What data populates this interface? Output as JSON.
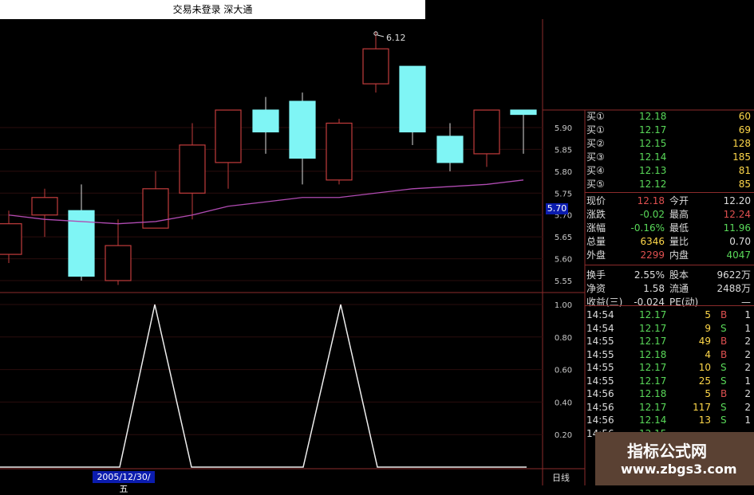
{
  "window": {
    "title": "交易未登录  深大通"
  },
  "chart": {
    "main_axis_labels": [
      "5.90",
      "5.85",
      "5.80",
      "5.75",
      "5.70",
      "5.65",
      "5.60",
      "5.55"
    ],
    "indicator_axis_labels": [
      "1.00",
      "0.80",
      "0.60",
      "0.40",
      "0.20"
    ],
    "high_annotation": "6.12",
    "current_price_box": "5.70",
    "date_label": "2005/12/30/五",
    "period_label": "日线",
    "colors": {
      "up": "#c23c3c",
      "down": "#7ff5f5",
      "ma": "#b04bb2",
      "grid": "#8b2b2b",
      "text": "#ddd"
    }
  },
  "chart_data": [
    {
      "type": "candlestick",
      "title": "",
      "yticks": [
        5.55,
        5.6,
        5.65,
        5.7,
        5.75,
        5.8,
        5.85,
        5.9
      ],
      "candles": [
        {
          "open": 5.61,
          "close": 5.68,
          "high": 5.71,
          "low": 5.59,
          "dir": "up"
        },
        {
          "open": 5.7,
          "close": 5.74,
          "high": 5.76,
          "low": 5.65,
          "dir": "up"
        },
        {
          "open": 5.71,
          "close": 5.56,
          "high": 5.77,
          "low": 5.55,
          "dir": "down"
        },
        {
          "open": 5.55,
          "close": 5.63,
          "high": 5.69,
          "low": 5.54,
          "dir": "up"
        },
        {
          "open": 5.67,
          "close": 5.76,
          "high": 5.8,
          "low": 5.67,
          "dir": "up"
        },
        {
          "open": 5.75,
          "close": 5.86,
          "high": 5.91,
          "low": 5.69,
          "dir": "up"
        },
        {
          "open": 5.82,
          "close": 5.94,
          "high": 5.94,
          "low": 5.76,
          "dir": "up"
        },
        {
          "open": 5.94,
          "close": 5.89,
          "high": 5.97,
          "low": 5.84,
          "dir": "down"
        },
        {
          "open": 5.96,
          "close": 5.83,
          "high": 5.98,
          "low": 5.77,
          "dir": "down"
        },
        {
          "open": 5.78,
          "close": 5.91,
          "high": 5.92,
          "low": 5.77,
          "dir": "up"
        },
        {
          "open": 6.08,
          "close": 6.0,
          "high": 6.12,
          "low": 5.98,
          "dir": "up"
        },
        {
          "open": 6.04,
          "close": 5.89,
          "high": 6.04,
          "low": 5.86,
          "dir": "down"
        },
        {
          "open": 5.88,
          "close": 5.82,
          "high": 5.91,
          "low": 5.8,
          "dir": "down"
        },
        {
          "open": 5.84,
          "close": 5.94,
          "high": 5.94,
          "low": 5.81,
          "dir": "up"
        },
        {
          "open": 5.94,
          "close": 5.93,
          "high": 5.94,
          "low": 5.84,
          "dir": "down"
        }
      ],
      "ma": [
        5.7,
        5.69,
        5.685,
        5.68,
        5.685,
        5.7,
        5.72,
        5.73,
        5.74,
        5.74,
        5.75,
        5.76,
        5.765,
        5.77,
        5.78
      ]
    },
    {
      "type": "line",
      "title": "",
      "yticks": [
        0.2,
        0.4,
        0.6,
        0.8,
        1.0
      ],
      "x": [
        1,
        2,
        3,
        4,
        5,
        6,
        7,
        8,
        9,
        10,
        11,
        12,
        13,
        14,
        15,
        16,
        17,
        18,
        19,
        20,
        21,
        22,
        23,
        24,
        25,
        26
      ],
      "values": [
        0,
        0,
        0,
        0,
        1,
        0,
        0,
        0,
        0,
        0,
        0,
        0,
        0,
        0,
        0,
        0,
        0,
        0,
        0,
        0,
        0,
        0,
        0,
        1,
        0,
        0
      ]
    }
  ],
  "quotes": {
    "bids_asks": [
      {
        "label": "买①",
        "price": "12.18",
        "vol": "60"
      },
      {
        "label": "买①",
        "price": "12.17",
        "vol": "69"
      },
      {
        "label": "买②",
        "price": "12.15",
        "vol": "128"
      },
      {
        "label": "买③",
        "price": "12.14",
        "vol": "185"
      },
      {
        "label": "买④",
        "price": "12.13",
        "vol": "81"
      },
      {
        "label": "买⑤",
        "price": "12.12",
        "vol": "85"
      }
    ],
    "stats": [
      {
        "l1": "现价",
        "v1": "12.18",
        "l2": "今开",
        "v2": "12.20"
      },
      {
        "l1": "涨跌",
        "v1": "-0.02",
        "l2": "最高",
        "v2": "12.24"
      },
      {
        "l1": "涨幅",
        "v1": "-0.16%",
        "l2": "最低",
        "v2": "11.96"
      },
      {
        "l1": "总量",
        "v1": "6346",
        "l2": "量比",
        "v2": "0.70"
      },
      {
        "l1": "外盘",
        "v1": "2299",
        "l2": "内盘",
        "v2": "4047"
      },
      {
        "l1": "换手",
        "v1": "2.55%",
        "l2": "股本",
        "v2": "9622万"
      },
      {
        "l1": "净资",
        "v1": "1.58",
        "l2": "流通",
        "v2": "2488万"
      },
      {
        "l1": "收益(三)",
        "v1": "-0.024",
        "l2": "PE(动)",
        "v2": "—"
      }
    ],
    "ticks": [
      {
        "time": "14:54",
        "price": "12.17",
        "vol": "5",
        "side": "B",
        "n": "1"
      },
      {
        "time": "14:54",
        "price": "12.17",
        "vol": "9",
        "side": "S",
        "n": "1"
      },
      {
        "time": "14:55",
        "price": "12.17",
        "vol": "49",
        "side": "B",
        "n": "2"
      },
      {
        "time": "14:55",
        "price": "12.18",
        "vol": "4",
        "side": "B",
        "n": "2"
      },
      {
        "time": "14:55",
        "price": "12.17",
        "vol": "10",
        "side": "S",
        "n": "2"
      },
      {
        "time": "14:55",
        "price": "12.17",
        "vol": "25",
        "side": "S",
        "n": "1"
      },
      {
        "time": "14:56",
        "price": "12.18",
        "vol": "5",
        "side": "B",
        "n": "2"
      },
      {
        "time": "14:56",
        "price": "12.17",
        "vol": "117",
        "side": "S",
        "n": "2"
      },
      {
        "time": "14:56",
        "price": "12.14",
        "vol": "13",
        "side": "S",
        "n": "1"
      },
      {
        "time": "14:56",
        "price": "12.15",
        "vol": "",
        "side": "",
        "n": ""
      }
    ]
  },
  "watermark": {
    "title": "指标公式网",
    "url": "www.zbgs3.com"
  }
}
